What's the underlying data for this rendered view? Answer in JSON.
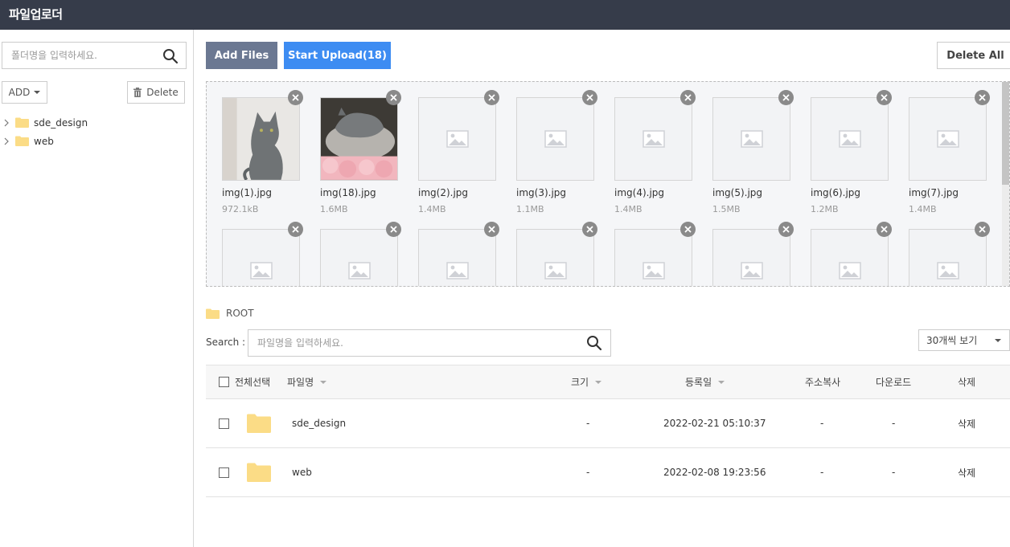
{
  "app": {
    "title": "파일업로더"
  },
  "sidebar": {
    "search_placeholder": "폴더명을 입력하세요.",
    "add_label": "ADD",
    "delete_label": "Delete",
    "folders": [
      {
        "label": "sde_design"
      },
      {
        "label": "web"
      }
    ]
  },
  "toolbar": {
    "add_files_label": "Add Files",
    "start_upload_label": "Start Upload(18)",
    "delete_all_label": "Delete All"
  },
  "upload_queue": [
    {
      "name": "img(1).jpg",
      "size": "972.1kB",
      "preview": "cat-photo-1"
    },
    {
      "name": "img(18).jpg",
      "size": "1.6MB",
      "preview": "cat-photo-2"
    },
    {
      "name": "img(2).jpg",
      "size": "1.4MB",
      "preview": "placeholder-image"
    },
    {
      "name": "img(3).jpg",
      "size": "1.1MB",
      "preview": "placeholder-image"
    },
    {
      "name": "img(4).jpg",
      "size": "1.4MB",
      "preview": "placeholder-image"
    },
    {
      "name": "img(5).jpg",
      "size": "1.5MB",
      "preview": "placeholder-image"
    },
    {
      "name": "img(6).jpg",
      "size": "1.2MB",
      "preview": "placeholder-image"
    },
    {
      "name": "img(7).jpg",
      "size": "1.4MB",
      "preview": "placeholder-image"
    },
    {
      "name": "",
      "size": "",
      "preview": "placeholder-image"
    },
    {
      "name": "",
      "size": "",
      "preview": "placeholder-image"
    },
    {
      "name": "",
      "size": "",
      "preview": "placeholder-image"
    },
    {
      "name": "",
      "size": "",
      "preview": "placeholder-image"
    },
    {
      "name": "",
      "size": "",
      "preview": "placeholder-image"
    },
    {
      "name": "",
      "size": "",
      "preview": "placeholder-image"
    },
    {
      "name": "",
      "size": "",
      "preview": "placeholder-image"
    },
    {
      "name": "",
      "size": "",
      "preview": "placeholder-image"
    }
  ],
  "breadcrumb": {
    "root_label": "ROOT"
  },
  "file_search": {
    "label": "Search :",
    "placeholder": "파일명을 입력하세요."
  },
  "per_page": {
    "selected": "30개씩 보기"
  },
  "table": {
    "headers": {
      "select_all": "전체선택",
      "name": "파일명",
      "size": "크기",
      "date": "등록일",
      "copy_url": "주소복사",
      "download": "다운로드",
      "delete": "삭제"
    },
    "rows": [
      {
        "name": "sde_design",
        "size": "-",
        "date": "2022-02-21 05:10:37",
        "copy_url": "-",
        "download": "-",
        "delete": "삭제"
      },
      {
        "name": "web",
        "size": "-",
        "date": "2022-02-08 19:23:56",
        "copy_url": "-",
        "download": "-",
        "delete": "삭제"
      }
    ]
  },
  "colors": {
    "topbar": "#363c4a",
    "add_files_button": "#6b7892",
    "upload_button": "#3d8cf2",
    "folder_icon": "#fbdc86",
    "remove_badge": "#8a8a8a"
  }
}
